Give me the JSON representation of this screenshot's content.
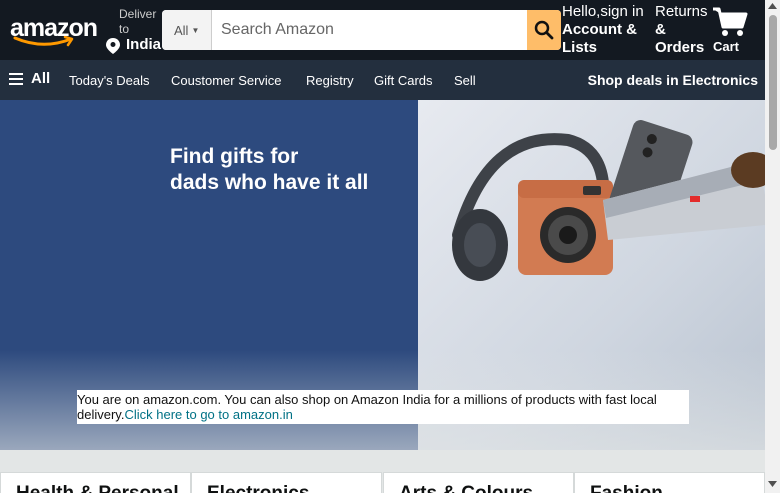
{
  "header": {
    "logo_text": "amazon",
    "deliver_label": "Deliver to",
    "deliver_location": "India",
    "search": {
      "category": "All",
      "placeholder": "Search Amazon",
      "value": ""
    },
    "account_greeting": "Hello,sign in",
    "account_label": "Account & Lists",
    "returns_label": "Returns",
    "orders_label": "& Orders",
    "cart_label": "Cart"
  },
  "subnav": {
    "all_label": "All",
    "links": [
      "Today's Deals",
      "Coustomer Service",
      "Registry",
      "Gift Cards",
      "Sell"
    ],
    "promo": "Shop deals in Electronics"
  },
  "hero": {
    "title_line1": "Find gifts for",
    "title_line2": "dads who have it all"
  },
  "notice": {
    "text": "You are on amazon.com. You can also shop on Amazon India for a millions of products with fast local delivery.",
    "link": "Click here to go to amazon.in"
  },
  "cards": [
    {
      "title": "Health & Personal"
    },
    {
      "title": "Electronics"
    },
    {
      "title": "Arts & Colours"
    },
    {
      "title": "Fashion"
    }
  ],
  "colors": {
    "nav_bg": "#131921",
    "subnav_bg": "#232f3e",
    "search_button": "#febd69",
    "hero_left": "#2d4a7e",
    "link": "#007185"
  }
}
